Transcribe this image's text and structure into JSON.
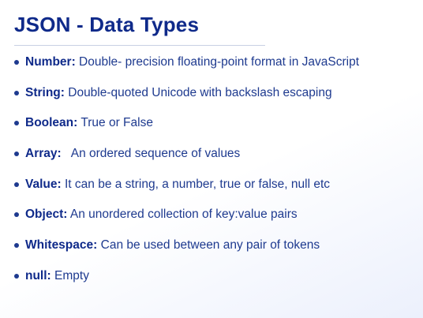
{
  "slide": {
    "title": "JSON - Data Types",
    "bullets": [
      {
        "term": "Number:",
        "description": "Double- precision floating-point format in JavaScript"
      },
      {
        "term": "String:",
        "description": "Double-quoted Unicode with backslash escaping"
      },
      {
        "term": "Boolean:",
        "description": "True or False"
      },
      {
        "term": "Array:",
        "description": " An ordered sequence of values"
      },
      {
        "term": "Value:",
        "description": "It can be a string, a number, true or false, null etc"
      },
      {
        "term": "Object:",
        "description": "An unordered collection of key:value pairs"
      },
      {
        "term": "Whitespace:",
        "description": "Can be used between any pair of tokens"
      },
      {
        "term": "null:",
        "description": "Empty"
      }
    ]
  }
}
